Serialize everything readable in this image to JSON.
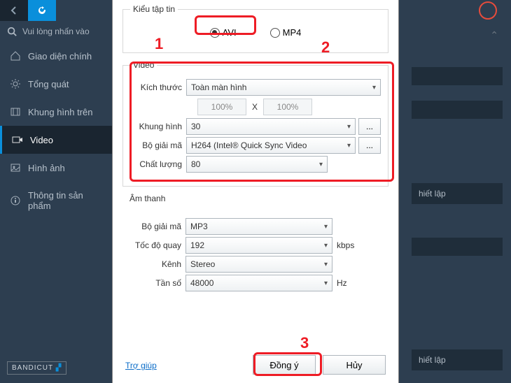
{
  "sidebar": {
    "search_placeholder": "Vui lòng nhấn vào",
    "items": [
      {
        "label": "Giao diện chính"
      },
      {
        "label": "Tổng quát"
      },
      {
        "label": "Khung hình trên"
      },
      {
        "label": "Video"
      },
      {
        "label": "Hình ảnh"
      },
      {
        "label": "Thông tin sản phẩm"
      }
    ],
    "brand": "BANDICUT"
  },
  "bg": {
    "setup": "hiết lập"
  },
  "dialog": {
    "group_file": "Kiểu tập tin",
    "radio_avi": "AVI",
    "radio_mp4": "MP4",
    "group_video": "Video",
    "size_label": "Kích thước",
    "size_value": "Toàn màn hình",
    "pct": "100%",
    "x": "X",
    "fps_label": "Khung hình",
    "fps_value": "30",
    "codec_label": "Bộ giải mã",
    "codec_value": "H264 (Intel® Quick Sync Video",
    "quality_label": "Chất lượng",
    "quality_value": "80",
    "dots": "...",
    "group_audio": "Âm thanh",
    "acodec_label": "Bộ giải mã",
    "acodec_value": "MP3",
    "bitrate_label": "Tốc độ quay",
    "bitrate_value": "192",
    "bitrate_unit": "kbps",
    "channel_label": "Kênh",
    "channel_value": "Stereo",
    "freq_label": "Tần số",
    "freq_value": "48000",
    "freq_unit": "Hz",
    "help": "Trợ giúp",
    "ok": "Đồng ý",
    "cancel": "Hủy"
  },
  "annotations": {
    "a1": "1",
    "a2": "2",
    "a3": "3"
  }
}
